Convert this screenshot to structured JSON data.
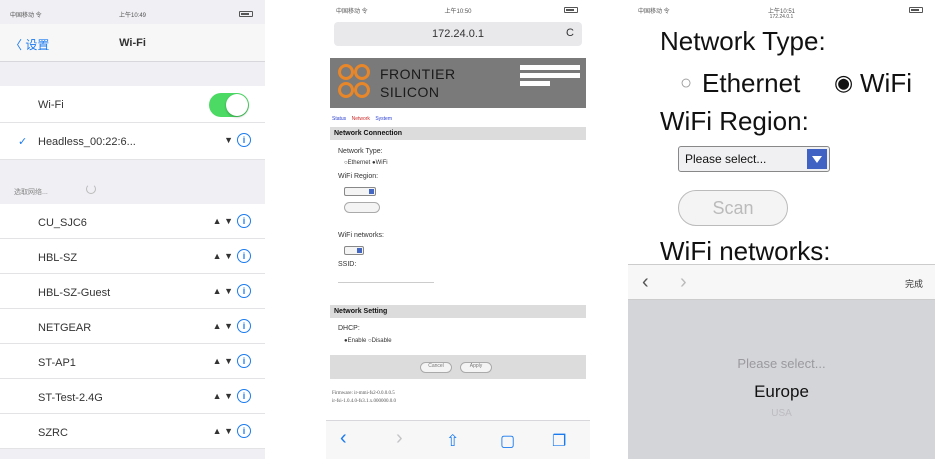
{
  "panel1": {
    "status": {
      "carrier": "中国移动 令",
      "time": "上午10:49"
    },
    "back_label": "〈 设置",
    "title": "Wi-Fi",
    "wifi_label": "Wi-Fi",
    "wifi_on": true,
    "connected": {
      "check": "✓",
      "ssid": "Headless_00:22:6..."
    },
    "section_label": "选取网络...",
    "networks": [
      "CU_SJC6",
      "HBL-SZ",
      "HBL-SZ-Guest",
      "NETGEAR",
      "ST-AP1",
      "ST-Test-2.4G",
      "SZRC"
    ],
    "info_glyph": "i",
    "net_glyphs": "▲ ▼"
  },
  "panel2": {
    "status": {
      "carrier": "中国移动 令",
      "time": "上午10:50"
    },
    "url": "172.24.0.1",
    "reload": "C",
    "brand_line1": "FRONTIER",
    "brand_line2": "SILICON",
    "tabs": [
      "Status",
      "Network",
      "System"
    ],
    "network_connection": "Network Connection",
    "network_type": "Network Type:",
    "type_options": "○Ethernet ●WiFi",
    "wifi_region": "WiFi Region:",
    "wifi_networks": "WiFi networks:",
    "ssid": "SSID:",
    "network_setting": "Network Setting",
    "dhcp": "DHCP:",
    "dhcp_options": "●Enable ○Disable",
    "cancel": "Cancel",
    "apply": "Apply",
    "firmware_line1": "Firmware: ir-mmi-fs2-0.0.0.0.5",
    "firmware_line2": "ir-fsi-1.0.4.0-fs3.1.x.000000.0.0",
    "toolbar": {
      "back": "‹",
      "forward": "›",
      "share": "⇧",
      "book": "▢",
      "tabs": "❐"
    }
  },
  "panel3": {
    "status": {
      "carrier": "中国移动 令",
      "time": "上午10:51",
      "url": "172.24.0.1"
    },
    "network_type": "Network Type:",
    "ethernet": "Ethernet",
    "wifi": "WiFi",
    "wifi_region": "WiFi Region:",
    "select_placeholder": "Please select...",
    "scan": "Scan",
    "wifi_networks": "WiFi networks:",
    "prev": "‹",
    "next": "›",
    "done": "完成",
    "picker_options": [
      "Please select...",
      "Europe",
      "USA"
    ]
  }
}
